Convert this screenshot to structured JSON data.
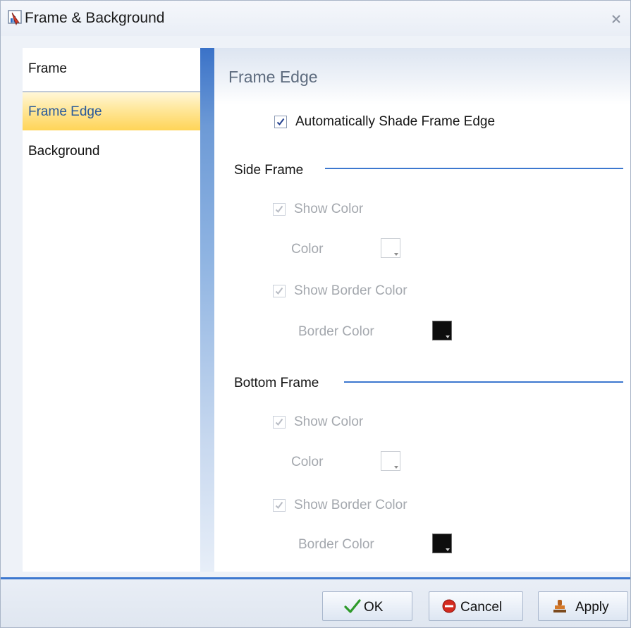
{
  "window": {
    "title": "Frame & Background"
  },
  "icons": {
    "title": "chart-frame-icon",
    "close": "close-icon",
    "ok": "checkmark-icon",
    "cancel": "cancel-icon",
    "apply": "stamp-icon"
  },
  "colors": {
    "accent": "#3d78cf",
    "selected_nav": "#ffe08a",
    "disabled_text": "#a4a8ae"
  },
  "nav": {
    "items": [
      {
        "label": "Frame",
        "selected": false
      },
      {
        "label": "Frame Edge",
        "selected": true
      },
      {
        "label": "Background",
        "selected": false
      }
    ]
  },
  "panel": {
    "title": "Frame Edge",
    "auto_shade": {
      "label": "Automatically Shade Frame Edge",
      "checked": true,
      "enabled": true
    },
    "side_frame": {
      "title": "Side Frame",
      "show_color": {
        "label": "Show Color",
        "checked": true,
        "enabled": false
      },
      "color": {
        "label": "Color",
        "value": "#ffffff"
      },
      "show_border_color": {
        "label": "Show Border Color",
        "checked": true,
        "enabled": false
      },
      "border_color": {
        "label": "Border Color",
        "value": "#000000"
      }
    },
    "bottom_frame": {
      "title": "Bottom Frame",
      "show_color": {
        "label": "Show Color",
        "checked": true,
        "enabled": false
      },
      "color": {
        "label": "Color",
        "value": "#ffffff"
      },
      "show_border_color": {
        "label": "Show Border Color",
        "checked": true,
        "enabled": false
      },
      "border_color": {
        "label": "Border Color",
        "value": "#000000"
      }
    }
  },
  "buttons": {
    "ok": "OK",
    "cancel": "Cancel",
    "apply": "Apply"
  }
}
